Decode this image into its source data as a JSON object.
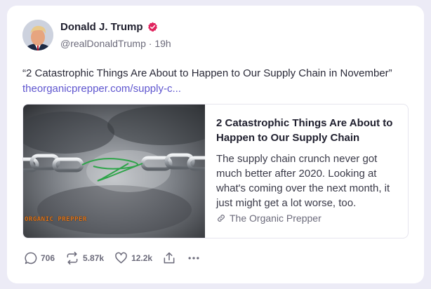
{
  "post": {
    "author_name": "Donald J. Trump",
    "handle": "@realDonaldTrump",
    "separator": "·",
    "time": "19h",
    "text": "“2 Catastrophic Things Are About to Happen to Our Supply Chain in November”",
    "link_text": "theorganicprepper.com/supply-c...",
    "verified_color": "#e0245e",
    "link_color": "#5f56cf"
  },
  "link_card": {
    "title": "2 Catastrophic Things Are About to Happen to Our Supply Chain",
    "description": "The supply chain crunch never got much better after 2020. Looking at what's coming over the next month, it just might get a lot worse, too.",
    "source": "The Organic Prepper",
    "image_watermark": "ORGANIC PREPPER"
  },
  "actions": {
    "replies": "706",
    "reposts": "5.87k",
    "likes": "12.2k"
  },
  "icons": {
    "verified": "verified-badge-icon",
    "source": "link-icon",
    "reply": "comment-icon",
    "repost": "repost-icon",
    "like": "heart-icon",
    "share": "share-icon",
    "more": "more-icon"
  }
}
